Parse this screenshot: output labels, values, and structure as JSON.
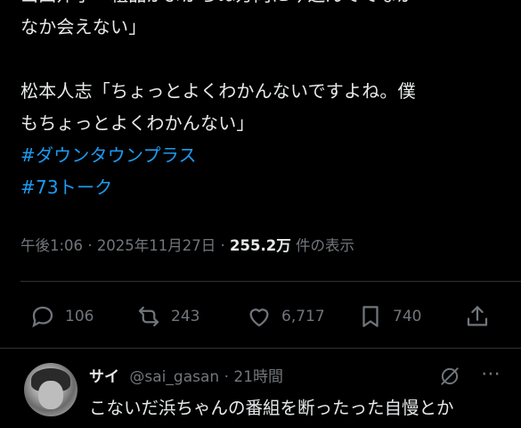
{
  "tweet": {
    "lines": [
      "山田邦子「粗品がよからぬ方向に今進んでてなか",
      "なか会えない」",
      "松本人志「ちょっとよくわかんないですよね。僕",
      "もちょっとよくわかんない」"
    ],
    "hashtags": [
      "#ダウンタウンプラス",
      "#73トーク"
    ],
    "time": "午後1:06",
    "date": "2025年11月27日",
    "views_count": "255.2万",
    "views_label": "件の表示",
    "separator": "·"
  },
  "actions": {
    "reply": {
      "icon": "reply-icon",
      "count": "106"
    },
    "retweet": {
      "icon": "retweet-icon",
      "count": "243"
    },
    "like": {
      "icon": "heart-icon",
      "count": "6,717"
    },
    "bookmark": {
      "icon": "bookmark-icon",
      "count": "740"
    },
    "share": {
      "icon": "share-icon"
    }
  },
  "reply": {
    "name": "サイ",
    "handle": "@sai_gasan",
    "separator": "·",
    "time": "21時間",
    "text": "こないだ浜ちゃんの番組を断ったった自慢とか"
  },
  "colors": {
    "background": "#000000",
    "text": "#e7e9ea",
    "muted": "#71767b",
    "link": "#1d9bf0",
    "divider": "#2f3336"
  }
}
